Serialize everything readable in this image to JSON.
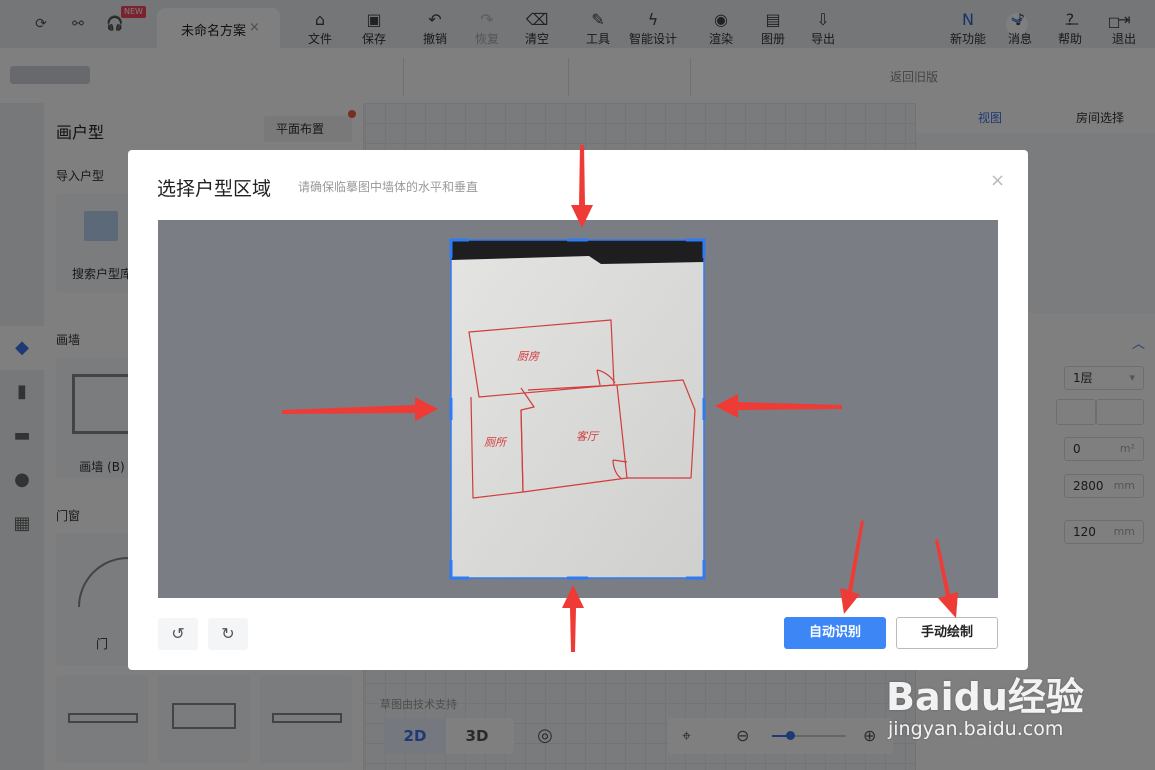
{
  "titlebar": {
    "new_badge": "NEW",
    "tab_title": "未命名方案",
    "tab_close": "×"
  },
  "toolbar": {
    "file": "文件",
    "save": "保存",
    "undo": "撤销",
    "redo": "恢复",
    "clear": "清空",
    "tools": "工具",
    "smart_design": "智能设计",
    "render": "渲染",
    "album": "图册",
    "export": "导出",
    "back_old": "返回旧版",
    "new_features": "新功能",
    "messages": "消息",
    "help": "帮助",
    "exit": "退出"
  },
  "left_panel": {
    "title": "画户型",
    "layout_button": "平面布置",
    "import_section": "导入户型",
    "search_card": "搜索户型库",
    "wall_section": "画墙",
    "wall_card": "画墙 (B)",
    "door_section": "门窗",
    "door_card": "门"
  },
  "right_panel": {
    "tab_view": "视图",
    "tab_room": "房间选择",
    "floor_select": "1层",
    "area_value": "0",
    "area_unit": "m²",
    "height_value": "2800",
    "height_unit": "mm",
    "thickness_value": "120",
    "thickness_unit": "mm"
  },
  "canvas": {
    "support_text": "草图由技术支持",
    "btn_2d": "2D",
    "btn_3d": "3D"
  },
  "dialog": {
    "title": "选择户型区域",
    "subtitle": "请确保临摹图中墙体的水平和垂直",
    "close": "×",
    "auto_button": "自动识别",
    "manual_button": "手动绘制",
    "sketch_labels": {
      "kitchen": "厨房",
      "bathroom": "厕所",
      "living_room": "客厅"
    }
  },
  "watermark": {
    "logo": "Baidu经验",
    "url": "jingyan.baidu.com"
  },
  "colors": {
    "accent": "#3d86f6",
    "arrow": "#ef3b36",
    "crop_border": "#2d7cf6",
    "sketch_ink": "#d23c3c"
  }
}
